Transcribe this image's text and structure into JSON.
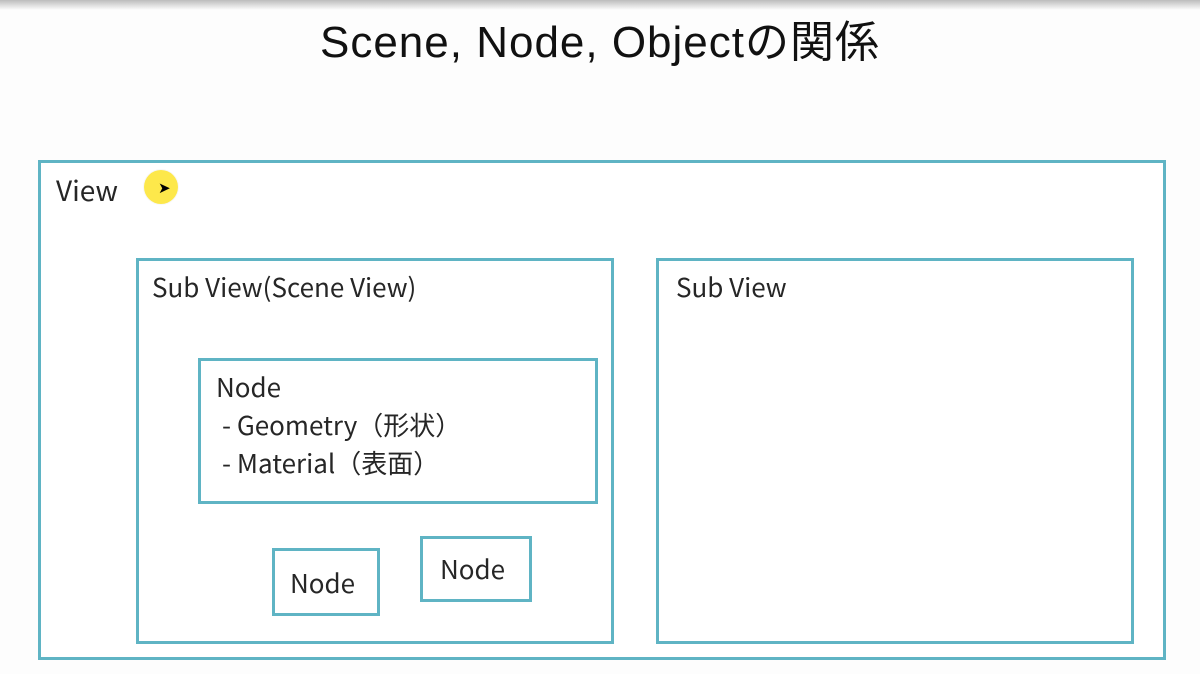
{
  "title": "Scene, Node, Objectの関係",
  "view": {
    "label": "View"
  },
  "subview_scene": {
    "label": "Sub View(Scene View)",
    "node_main": {
      "title": "Node",
      "line1": " - Geometry（形状）",
      "line2": " - Material（表面）"
    },
    "node_small_1": "Node",
    "node_small_2": "Node"
  },
  "subview_right": {
    "label": "Sub View"
  },
  "colors": {
    "border": "#5fb4c4",
    "highlight": "#fde84b"
  }
}
